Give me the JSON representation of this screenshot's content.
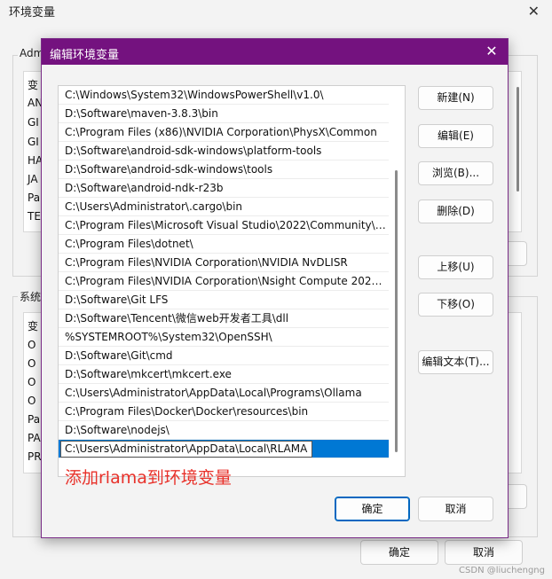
{
  "background_window": {
    "title": "环境变量",
    "user_group_label": "Adm",
    "user_list_header": "变",
    "user_rows": [
      "AN",
      "GI",
      "GI",
      "HA",
      "JA",
      "Pa",
      "TE"
    ],
    "system_group_label": "系统",
    "system_list_header": "变",
    "system_rows": [
      "O",
      "O",
      "O",
      "O",
      "Pa",
      "PA",
      "PR"
    ],
    "ok_label": "确定",
    "cancel_label": "取消",
    "watermark": "CSDN @liuchengng"
  },
  "dialog": {
    "title": "编辑环境变量",
    "paths": [
      "C:\\Windows\\System32\\WindowsPowerShell\\v1.0\\",
      "D:\\Software\\maven-3.8.3\\bin",
      "C:\\Program Files (x86)\\NVIDIA Corporation\\PhysX\\Common",
      "D:\\Software\\android-sdk-windows\\platform-tools",
      "D:\\Software\\android-sdk-windows\\tools",
      "D:\\Software\\android-ndk-r23b",
      "C:\\Users\\Administrator\\.cargo\\bin",
      "C:\\Program Files\\Microsoft Visual Studio\\2022\\Community\\V...",
      "C:\\Program Files\\dotnet\\",
      "C:\\Program Files\\NVIDIA Corporation\\NVIDIA NvDLISR",
      "C:\\Program Files\\NVIDIA Corporation\\Nsight Compute 2023....",
      "D:\\Software\\Git LFS",
      "D:\\Software\\Tencent\\微信web开发者工具\\dll",
      "%SYSTEMROOT%\\System32\\OpenSSH\\",
      "D:\\Software\\Git\\cmd",
      "D:\\Software\\mkcert\\mkcert.exe",
      "C:\\Users\\Administrator\\AppData\\Local\\Programs\\Ollama",
      "C:\\Program Files\\Docker\\Docker\\resources\\bin",
      "D:\\Software\\nodejs\\"
    ],
    "editing_value": "C:\\Users\\Administrator\\AppData\\Local\\RLAMA",
    "annotation": "添加rlama到环境变量",
    "buttons": {
      "new": "新建(N)",
      "edit": "编辑(E)",
      "browse": "浏览(B)...",
      "delete": "删除(D)",
      "move_up": "上移(U)",
      "move_down": "下移(O)",
      "edit_text": "编辑文本(T)..."
    },
    "ok_label": "确定",
    "cancel_label": "取消"
  },
  "colors": {
    "titlebar": "#74127f",
    "selection": "#0078d4",
    "annotation": "#e8312a"
  }
}
